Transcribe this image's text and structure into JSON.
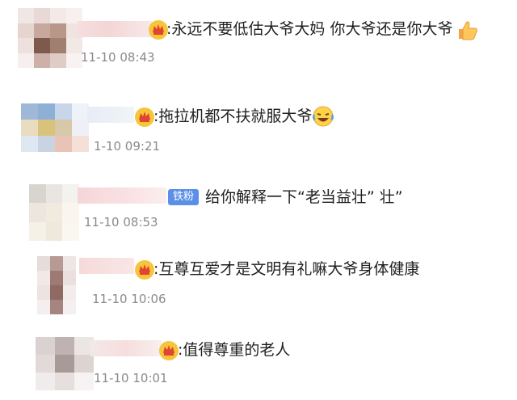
{
  "comments": [
    {
      "text": ":永远不要低估大爷大妈 你大爷还是你大爷",
      "time": "11-10 08:43",
      "badge": "crown-icon",
      "trailing_emoji": "thumbs-up-icon"
    },
    {
      "text": ":拖拉机都不扶就服大爷",
      "time": "1-10 09:21",
      "badge": "crown-icon",
      "trailing_emoji": "laughing-crying-icon"
    },
    {
      "text": "给你解释一下“老当益壮” 壮”",
      "time": "11-10 08:53",
      "badge": "fan-badge",
      "badge_label": "铁粉"
    },
    {
      "text": ":互尊互爱才是文明有礼嘛大爷身体健康",
      "time": "11-10 10:06",
      "badge": "crown-icon"
    },
    {
      "text": ":值得尊重的老人",
      "time": "11-10 10:01",
      "badge": "crown-icon"
    }
  ]
}
